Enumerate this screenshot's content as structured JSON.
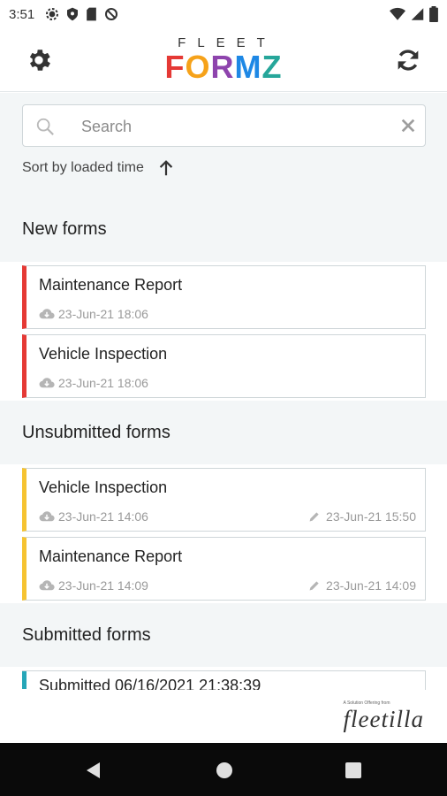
{
  "status_bar": {
    "time": "3:51"
  },
  "header": {
    "logo_top": "FLEET",
    "logo_main": [
      "F",
      "O",
      "R",
      "M",
      "Z"
    ]
  },
  "search": {
    "placeholder": "Search",
    "value": ""
  },
  "sort": {
    "label": "Sort by loaded time"
  },
  "sections": {
    "new": {
      "title": "New forms",
      "cards": [
        {
          "title": "Maintenance Report",
          "loaded": "23-Jun-21 18:06"
        },
        {
          "title": "Vehicle Inspection",
          "loaded": "23-Jun-21 18:06"
        }
      ]
    },
    "unsubmitted": {
      "title": "Unsubmitted forms",
      "cards": [
        {
          "title": "Vehicle Inspection",
          "loaded": "23-Jun-21 14:06",
          "edited": "23-Jun-21 15:50"
        },
        {
          "title": "Maintenance Report",
          "loaded": "23-Jun-21 14:09",
          "edited": "23-Jun-21 14:09"
        }
      ]
    },
    "submitted": {
      "title": "Submitted forms",
      "cards": [
        {
          "title": "Submitted 06/16/2021 21:38:39"
        }
      ]
    }
  },
  "footer": {
    "tagline": "A Solution Offering from",
    "brand": "fleetilla"
  },
  "colors": {
    "new": "#e53935",
    "unsubmitted": "#f6c331",
    "submitted": "#26a6b8"
  }
}
